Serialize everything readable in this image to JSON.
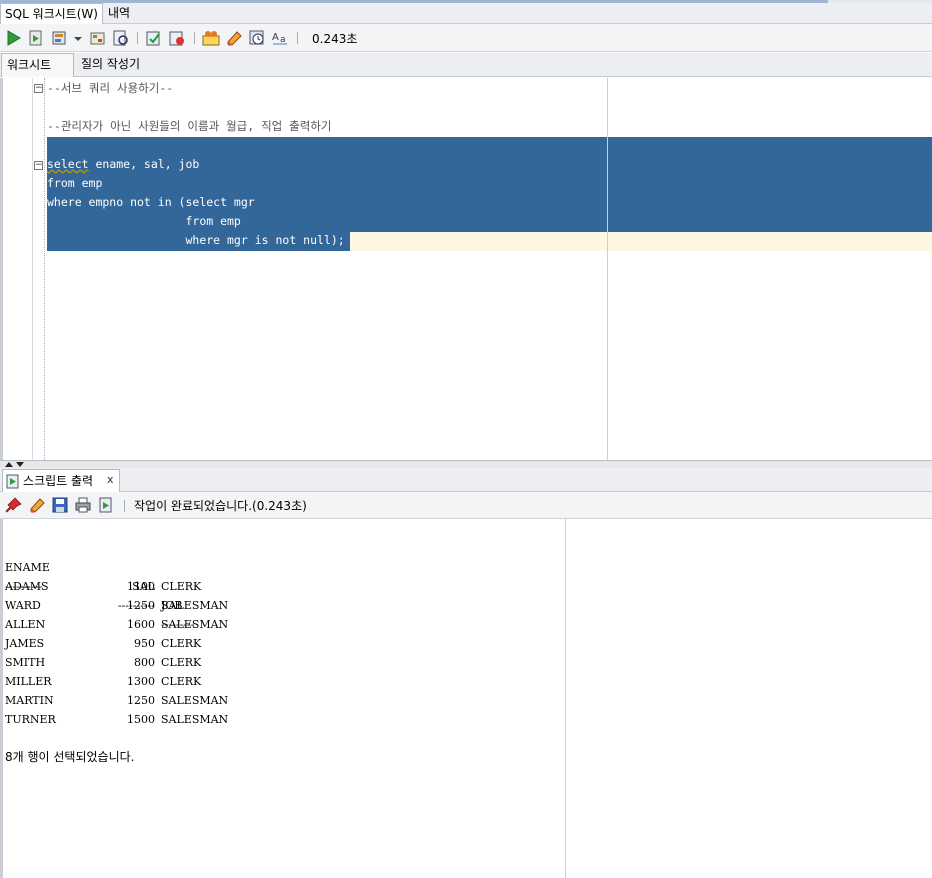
{
  "window_tabs": [
    {
      "label": "SQL 워크시트(W)",
      "active": true
    },
    {
      "label": "내역",
      "active": false
    }
  ],
  "toolbar": {
    "timer": "0.243초",
    "icons": [
      "run-statement-icon",
      "run-script-icon",
      "autotrace-icon",
      "dropdown-arrow-icon",
      "explain-plan-icon",
      "sql-tuning-icon",
      "commit-icon",
      "rollback-icon",
      "sql-format-icon",
      "clear-icon",
      "history-icon",
      "case-change-icon"
    ]
  },
  "editor_tabs": [
    {
      "label": "워크시트",
      "active": true
    },
    {
      "label": "질의 작성기",
      "active": false
    }
  ],
  "editor": {
    "lines": [
      "--서브 쿼리 사용하기--",
      "",
      "--관리자가 아닌 사원들의 이름과 월급, 직업 출력하기",
      "",
      "select ename, sal, job",
      "from emp",
      "where empno not in (select mgr",
      "                    from emp",
      "                    where mgr is not null);"
    ],
    "first_keyword": "select",
    "first_rest": " ename, sal, job"
  },
  "output_panel": {
    "tab_label": "스크립트 출력",
    "close_label": "x",
    "status": "작업이 완료되었습니다.(0.243초)",
    "headers": [
      "ENAME",
      "SAL",
      "JOB"
    ],
    "dividers": [
      "----------",
      "----------",
      "---------"
    ],
    "rows": [
      [
        "ADAMS",
        "1100",
        "CLERK"
      ],
      [
        "WARD",
        "1250",
        "SALESMAN"
      ],
      [
        "ALLEN",
        "1600",
        "SALESMAN"
      ],
      [
        "JAMES",
        "950",
        "CLERK"
      ],
      [
        "SMITH",
        "800",
        "CLERK"
      ],
      [
        "MILLER",
        "1300",
        "CLERK"
      ],
      [
        "MARTIN",
        "1250",
        "SALESMAN"
      ],
      [
        "TURNER",
        "1500",
        "SALESMAN"
      ]
    ],
    "summary": "8개 행이 선택되었습니다."
  }
}
